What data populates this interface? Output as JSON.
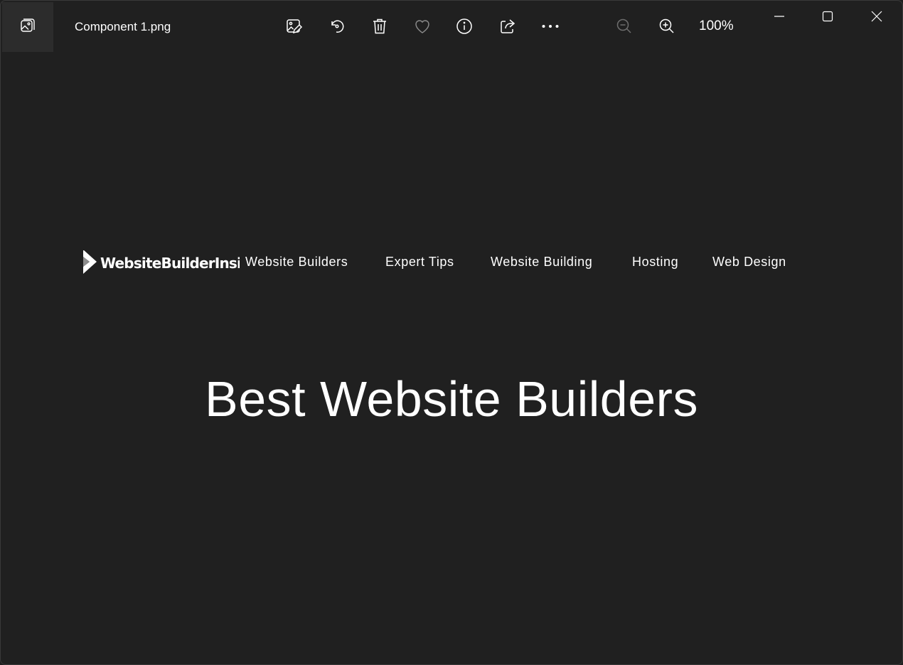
{
  "titlebar": {
    "file_name": "Component 1.png",
    "zoom": "100%",
    "toolbar_icons": [
      "edit-image-icon",
      "rotate-icon",
      "delete-icon",
      "favorite-icon",
      "info-icon",
      "share-icon",
      "more-icon",
      "zoom-out-icon",
      "zoom-in-icon"
    ],
    "window_controls": [
      "minimize-icon",
      "maximize-icon",
      "close-icon"
    ]
  },
  "image": {
    "logo_text": "WebsiteBuilderInsi",
    "nav": [
      "Website Builders",
      "Expert Tips",
      "Website Building",
      "Hosting",
      "Web Design"
    ],
    "headline": "Best Website Builders"
  }
}
